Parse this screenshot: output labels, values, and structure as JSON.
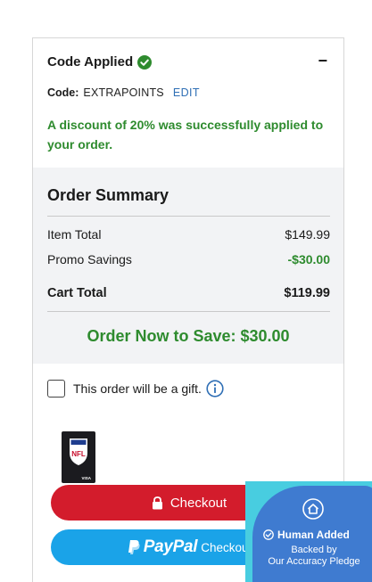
{
  "promo": {
    "title": "Code Applied",
    "collapse_symbol": "−",
    "code_label": "Code:",
    "code_value": "EXTRAPOINTS",
    "edit_label": "EDIT",
    "message": "A discount of 20% was successfully applied to your order."
  },
  "summary": {
    "title": "Order Summary",
    "rows": [
      {
        "label": "Item Total",
        "value": "$149.99"
      },
      {
        "label": "Promo Savings",
        "value": "-$30.00"
      }
    ],
    "total_label": "Cart Total",
    "total_value": "$119.99",
    "save_banner": "Order Now to Save: $30.00"
  },
  "gift": {
    "label": "This order will be a gift.",
    "checked": false
  },
  "card": {
    "brand_text": "NFL",
    "network_text": "VISA"
  },
  "actions": {
    "checkout_label": "Checkout",
    "paypal_word": "PayPal",
    "paypal_suffix": "Checkout"
  },
  "pledge": {
    "title": "Human Added",
    "subtitle_line1": "Backed by",
    "subtitle_line2": "Our Accuracy Pledge"
  },
  "colors": {
    "success_green": "#2e8b2e",
    "checkout_red": "#d31c2c",
    "paypal_blue": "#1aa3e8",
    "link_blue": "#2f6fb5",
    "summary_bg": "#f2f3f5"
  }
}
